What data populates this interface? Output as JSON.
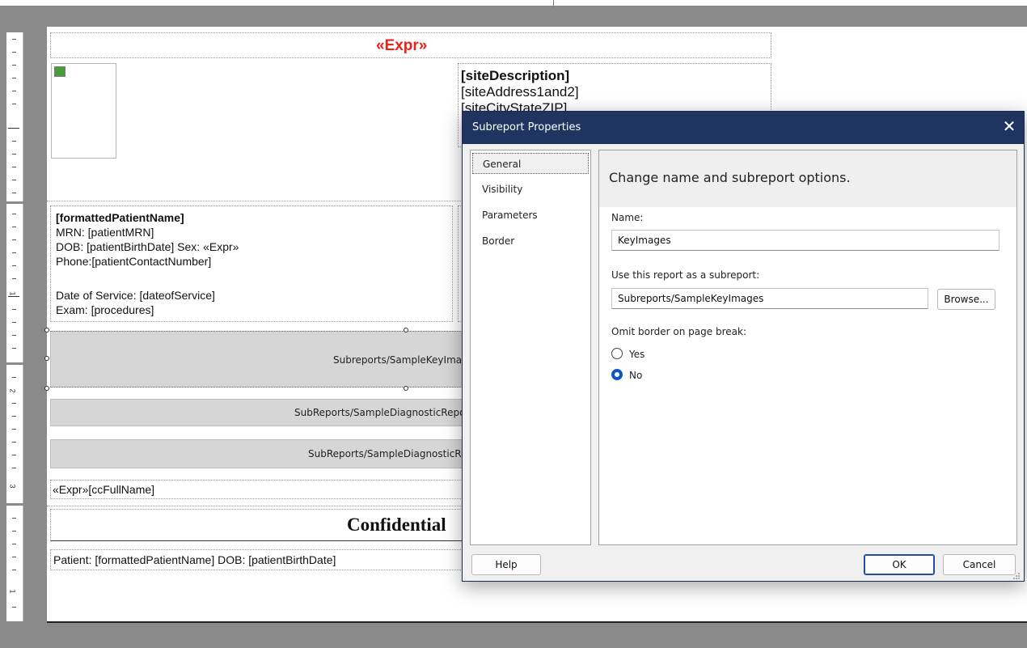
{
  "report": {
    "header_expr": "«Expr»",
    "site_description": "[siteDescription]",
    "site_address": "[siteAddress1and2]",
    "site_city": "[siteCityStateZIP]",
    "patient_name": "[formattedPatientName]",
    "mrn": "MRN: [patientMRN]",
    "dob_sex": "DOB: [patientBirthDate]    Sex: «Expr»",
    "phone": "Phone:[patientContactNumber]",
    "date_of_service": "Date of Service: [dateofService]",
    "exam": "Exam:  [procedures]",
    "subreport_1": "Subreports/SampleKeyImages",
    "subreport_2": "SubReports/SampleDiagnosticReport",
    "subreport_3": "SubReports/SampleDiagnosticReport",
    "cc_line": "«Expr»[ccFullName]",
    "confidential": "Confidential",
    "footer_line": "Patient: [formattedPatientName]   DOB: [patientBirthDate]"
  },
  "ruler": {
    "numbers": [
      "1",
      "2",
      "3",
      "1"
    ]
  },
  "dialog": {
    "title": "Subreport Properties",
    "nav": [
      "General",
      "Visibility",
      "Parameters",
      "Border"
    ],
    "selected_nav": "General",
    "heading": "Change name and subreport options.",
    "name_label": "Name:",
    "name_value": "KeyImages",
    "subreport_label": "Use this report as a subreport:",
    "subreport_value": "Subreports/SampleKeyImages",
    "browse_label": "Browse...",
    "omit_label": "Omit border on page break:",
    "options": [
      "Yes",
      "No"
    ],
    "selected_option": "No",
    "help_label": "Help",
    "ok_label": "OK",
    "cancel_label": "Cancel"
  },
  "colors": {
    "title_bar": "#1f3461",
    "expr_red": "#e8231b",
    "radio_selected": "#0b57c9",
    "workspace": "#8a8a8a"
  }
}
